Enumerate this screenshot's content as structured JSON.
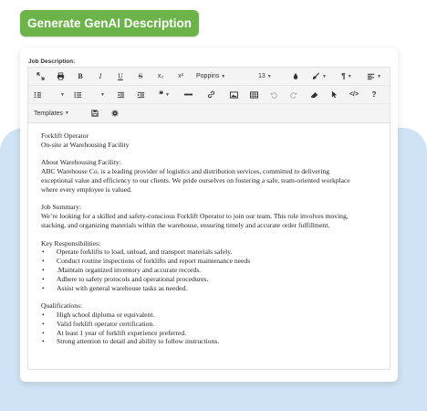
{
  "generate_button": "Generate GenAI Description",
  "field_label": "Job Description:",
  "toolbar": {
    "row1": {
      "bold": "B",
      "italic": "I",
      "underline": "U",
      "strike": "S",
      "subscript": "x₂",
      "superscript": "x²",
      "font": "Poppins",
      "size": "13"
    },
    "row3": {
      "templates": "Templates"
    }
  },
  "content": {
    "title": "Forklift Operator",
    "location": "On-site at Warehousing Facility",
    "about_heading": "About Warehousing Facility:",
    "about_text_1": "ABC Warehouse Co. is a leading provider of logistics and distribution services, committed to delivering",
    "about_text_2": "exceptional value and efficiency to our clients. We pride ourselves on fostering a safe, team-oriented workplace",
    "about_text_3": "where every employee is valued.",
    "summary_heading": "Job Summary:",
    "summary_text_1": "We’re looking for a skilled and safety-conscious Forklift Operator to join our team. This role involves moving,",
    "summary_text_2": "stacking, and organizing materials within the warehouse, ensuring timely and accurate order fulfillment.",
    "resp_heading": "Key Responsibilities:",
    "responsibilities": [
      "Operate forklifts to load, unload, and transport materials safely.",
      "Conduct routine inspections of forklifts and report maintenance needs",
      ".Maintain organized inventory and accurate records.",
      "Adhere to safety protocols and operational procedures.",
      "Assist with general warehouse tasks as needed."
    ],
    "qual_heading": "Qualifications:",
    "qualifications": [
      "High school diploma or equivalent.",
      "Valid forklift operator certification.",
      "At least 1 year of forklift experience preferred.",
      "Strong attention to detail and ability to follow instructions."
    ]
  },
  "colors": {
    "button_green": "#6cb34a",
    "background_blue": "#cfe3f4"
  }
}
